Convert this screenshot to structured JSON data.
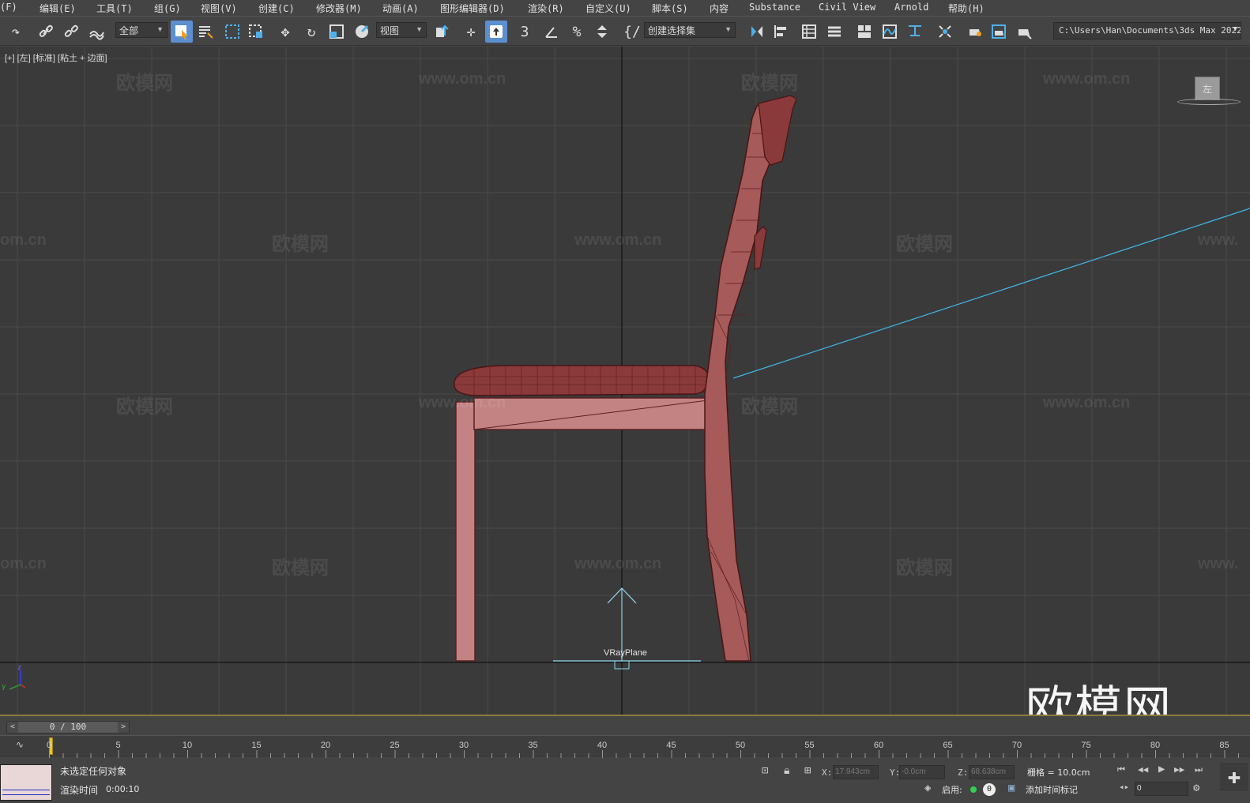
{
  "menu": [
    "(F)",
    "编辑(E)",
    "工具(T)",
    "组(G)",
    "视图(V)",
    "创建(C)",
    "修改器(M)",
    "动画(A)",
    "图形编辑器(D)",
    "渲染(R)",
    "自定义(U)",
    "脚本(S)",
    "内容",
    "Substance",
    "Civil View",
    "Arnold",
    "帮助(H)"
  ],
  "toolbar": {
    "filter_dropdown": "全部",
    "coord_dropdown": "视图",
    "selection_set": "创建选择集",
    "path": "C:\\Users\\Han\\Documents\\3ds Max 2022"
  },
  "viewport": {
    "label": "[+] [左] [标准] [粘土 + 边面]",
    "object_label": "VRayPlane",
    "viewcube_face": "左",
    "axis_z": "z",
    "axis_y": "y",
    "watermark_cn": "欧模网",
    "watermark_url": "www.om.cn",
    "watermark_url_cut": "om.cn",
    "watermark_url_cut2": "www."
  },
  "brand_watermark": "欧模网",
  "timeline": {
    "frame": "0 / 100",
    "ticks": [
      "0",
      "5",
      "10",
      "15",
      "20",
      "25",
      "30",
      "35",
      "40",
      "45",
      "50",
      "55",
      "60",
      "65",
      "70",
      "75",
      "80",
      "85"
    ]
  },
  "status": {
    "selection": "未选定任何对象",
    "render_time_label": "渲染时间",
    "render_time": "0:00:10",
    "x_label": "X:",
    "x_value": "17.943cm",
    "y_label": "Y:",
    "y_value": "-0.0cm",
    "z_label": "Z:",
    "z_value": "68.638cm",
    "grid": "栅格 = 10.0cm",
    "enable_label": "启用:",
    "enable_count": "0",
    "add_time_tag": "添加时间标记",
    "frame_field": "0"
  },
  "colors": {
    "chair": "#a75a5a",
    "chair_dark": "#7a2e2e",
    "light_line": "#3db8e8"
  }
}
